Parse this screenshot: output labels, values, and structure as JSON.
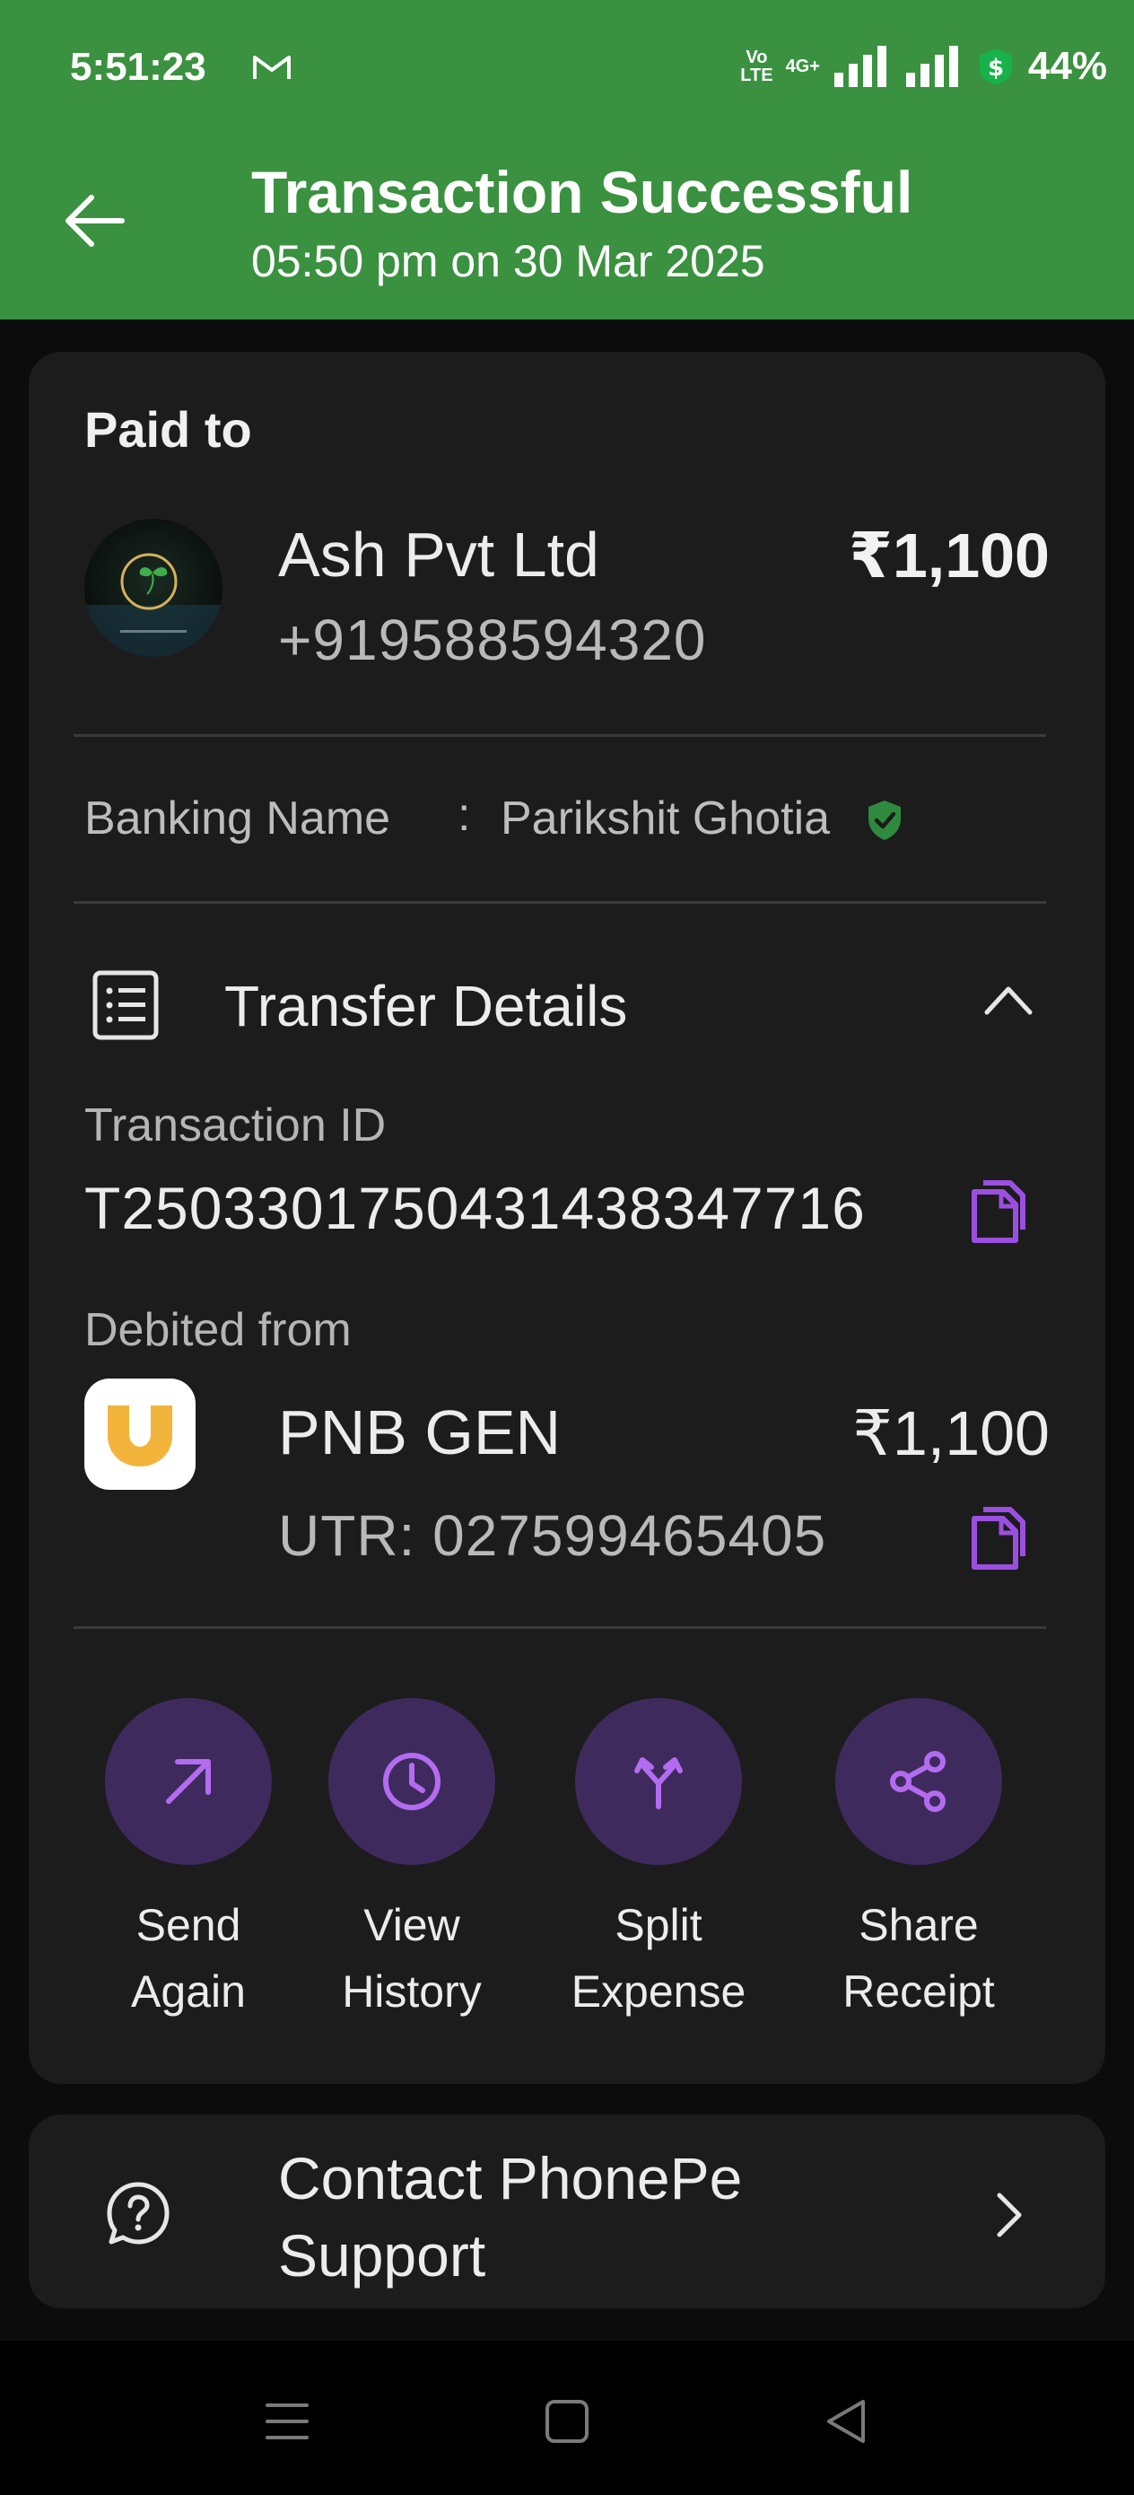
{
  "status_bar": {
    "time": "5:51:23",
    "volte_top": "Vo",
    "volte_bottom": "LTE",
    "network": "4G+",
    "battery": "44%",
    "icons": [
      "gmail-icon",
      "volte-icon",
      "signal-icon",
      "signal-icon",
      "dollar-badge-icon"
    ]
  },
  "header": {
    "title": "Transaction Successful",
    "subtitle": "05:50 pm on 30 Mar 2025",
    "background_color": "#3a913f"
  },
  "payee": {
    "section_label": "Paid to",
    "name": "Ash Pvt Ltd",
    "phone": "+919588594320",
    "amount": "₹1,100"
  },
  "banking": {
    "label": "Banking Name",
    "separator": ":",
    "name": "Parikshit Ghotia",
    "verified_color": "#2e8b3d"
  },
  "transfer_details": {
    "title": "Transfer Details",
    "transaction_id_label": "Transaction ID",
    "transaction_id": "T2503301750431438347716",
    "debited_from_label": "Debited from",
    "bank_name": "PNB GEN",
    "bank_amount": "₹1,100",
    "utr": "UTR: 027599465405",
    "accent_color": "#9b4fe0"
  },
  "actions": [
    {
      "line1": "Send",
      "line2": "Again",
      "icon": "send-arrow-icon"
    },
    {
      "line1": "View",
      "line2": "History",
      "icon": "clock-icon"
    },
    {
      "line1": "Split",
      "line2": "Expense",
      "icon": "split-icon"
    },
    {
      "line1": "Share",
      "line2": "Receipt",
      "icon": "share-icon"
    }
  ],
  "support": {
    "label": "Contact PhonePe Support"
  },
  "nav_bar": {
    "buttons": [
      "menu-icon",
      "home-icon",
      "back-icon"
    ]
  }
}
